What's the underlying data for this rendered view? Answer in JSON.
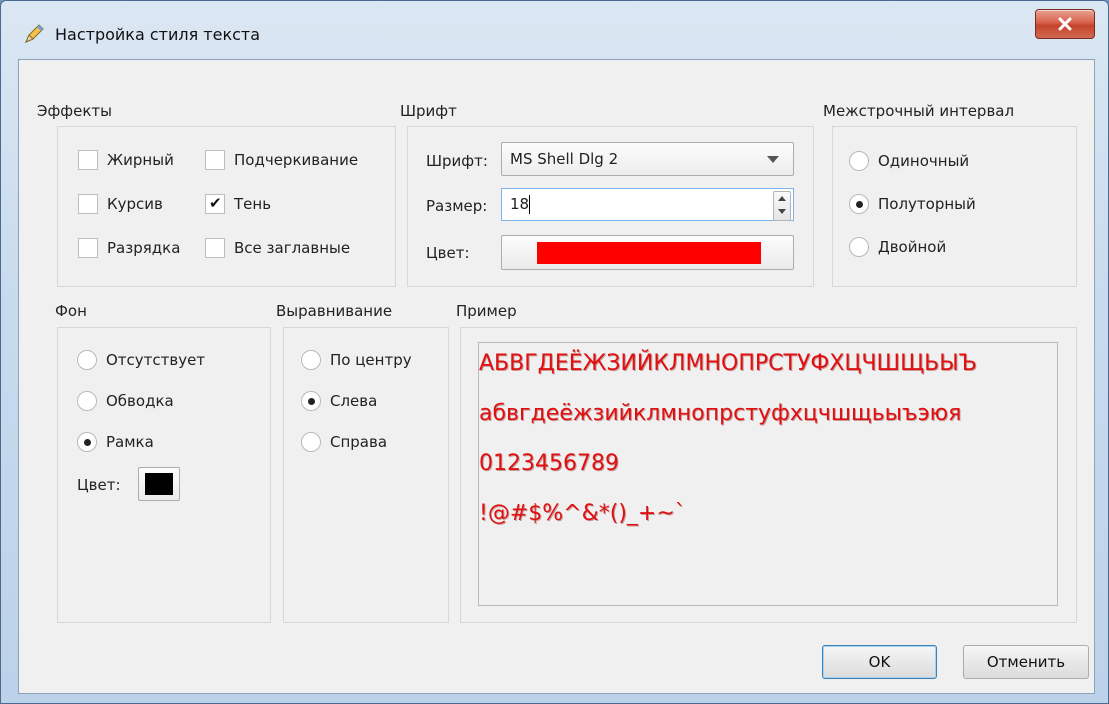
{
  "window": {
    "title": "Настройка стиля текста",
    "close_icon": "close-x-icon",
    "app_icon": "pencil-icon"
  },
  "effects": {
    "title": "Эффекты",
    "items": [
      {
        "label": "Жирный",
        "checked": false
      },
      {
        "label": "Подчеркивание",
        "checked": false
      },
      {
        "label": "Курсив",
        "checked": false
      },
      {
        "label": "Тень",
        "checked": true
      },
      {
        "label": "Разрядка",
        "checked": false
      },
      {
        "label": "Все заглавные",
        "checked": false
      }
    ]
  },
  "font": {
    "title": "Шрифт",
    "font_label": "Шрифт:",
    "font_value": "MS Shell Dlg 2",
    "size_label": "Размер:",
    "size_value": "18",
    "color_label": "Цвет:",
    "color_value": "#ff0000"
  },
  "line_spacing": {
    "title": "Межстрочный интервал",
    "options": [
      {
        "label": "Одиночный",
        "selected": false
      },
      {
        "label": "Полуторный",
        "selected": true
      },
      {
        "label": "Двойной",
        "selected": false
      }
    ]
  },
  "background": {
    "title": "Фон",
    "options": [
      {
        "label": "Отсутствует",
        "selected": false
      },
      {
        "label": "Обводка",
        "selected": false
      },
      {
        "label": "Рамка",
        "selected": true
      }
    ],
    "color_label": "Цвет:",
    "color_value": "#000000"
  },
  "alignment": {
    "title": "Выравнивание",
    "options": [
      {
        "label": "По центру",
        "selected": false
      },
      {
        "label": "Слева",
        "selected": true
      },
      {
        "label": "Справа",
        "selected": false
      }
    ]
  },
  "preview": {
    "title": "Пример",
    "text_color": "#e01010",
    "lines": [
      "АБВГДЕЁЖЗИЙКЛМНОПРСТУФХЦЧШЩЬЫЪ",
      "абвгдеёжзийклмнопрстуфхцчшщьыъэюя",
      "0123456789",
      "!@#$%^&*()_+~`"
    ]
  },
  "buttons": {
    "ok": "OK",
    "cancel": "Отменить"
  }
}
